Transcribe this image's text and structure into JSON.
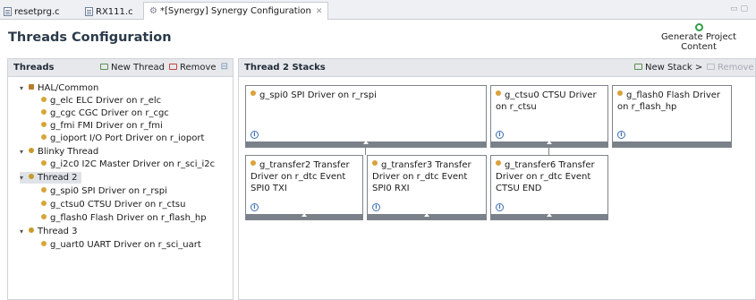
{
  "tabs": [
    {
      "label": "resetprg.c"
    },
    {
      "label": "RX111.c"
    },
    {
      "label": "*[Synergy] Synergy Configuration"
    }
  ],
  "header": {
    "title": "Threads Configuration",
    "generate_label": "Generate Project Content"
  },
  "threads_panel": {
    "title": "Threads",
    "new_thread_label": "New Thread",
    "remove_label": "Remove",
    "tree": [
      {
        "label": "HAL/Common",
        "level": 0
      },
      {
        "label": "g_elc ELC Driver on r_elc",
        "level": 1
      },
      {
        "label": "g_cgc CGC Driver on r_cgc",
        "level": 1
      },
      {
        "label": "g_fmi FMI Driver on r_fmi",
        "level": 1
      },
      {
        "label": "g_ioport I/O Port Driver on r_ioport",
        "level": 1
      },
      {
        "label": "Blinky Thread",
        "level": 0
      },
      {
        "label": "g_i2c0 I2C Master Driver on r_sci_i2c",
        "level": 1
      },
      {
        "label": "Thread 2",
        "level": 0,
        "selected": true
      },
      {
        "label": "g_spi0 SPI Driver on r_rspi",
        "level": 1
      },
      {
        "label": "g_ctsu0 CTSU Driver on r_ctsu",
        "level": 1
      },
      {
        "label": "g_flash0 Flash Driver on r_flash_hp",
        "level": 1
      },
      {
        "label": "Thread 3",
        "level": 0
      },
      {
        "label": "g_uart0 UART Driver on r_sci_uart",
        "level": 1
      }
    ]
  },
  "stacks_panel": {
    "title": "Thread 2 Stacks",
    "new_stack_label": "New Stack >",
    "remove_label": "Remove",
    "cards": [
      {
        "text": "g_spi0 SPI Driver on r_rspi"
      },
      {
        "text": "g_ctsu0 CTSU Driver on r_ctsu"
      },
      {
        "text": "g_flash0 Flash Driver on r_flash_hp"
      },
      {
        "text": "g_transfer2 Transfer Driver on r_dtc Event SPI0 TXI"
      },
      {
        "text": "g_transfer3 Transfer Driver on r_dtc Event SPI0 RXI"
      },
      {
        "text": "g_transfer6 Transfer Driver on r_dtc Event CTSU END"
      }
    ]
  }
}
